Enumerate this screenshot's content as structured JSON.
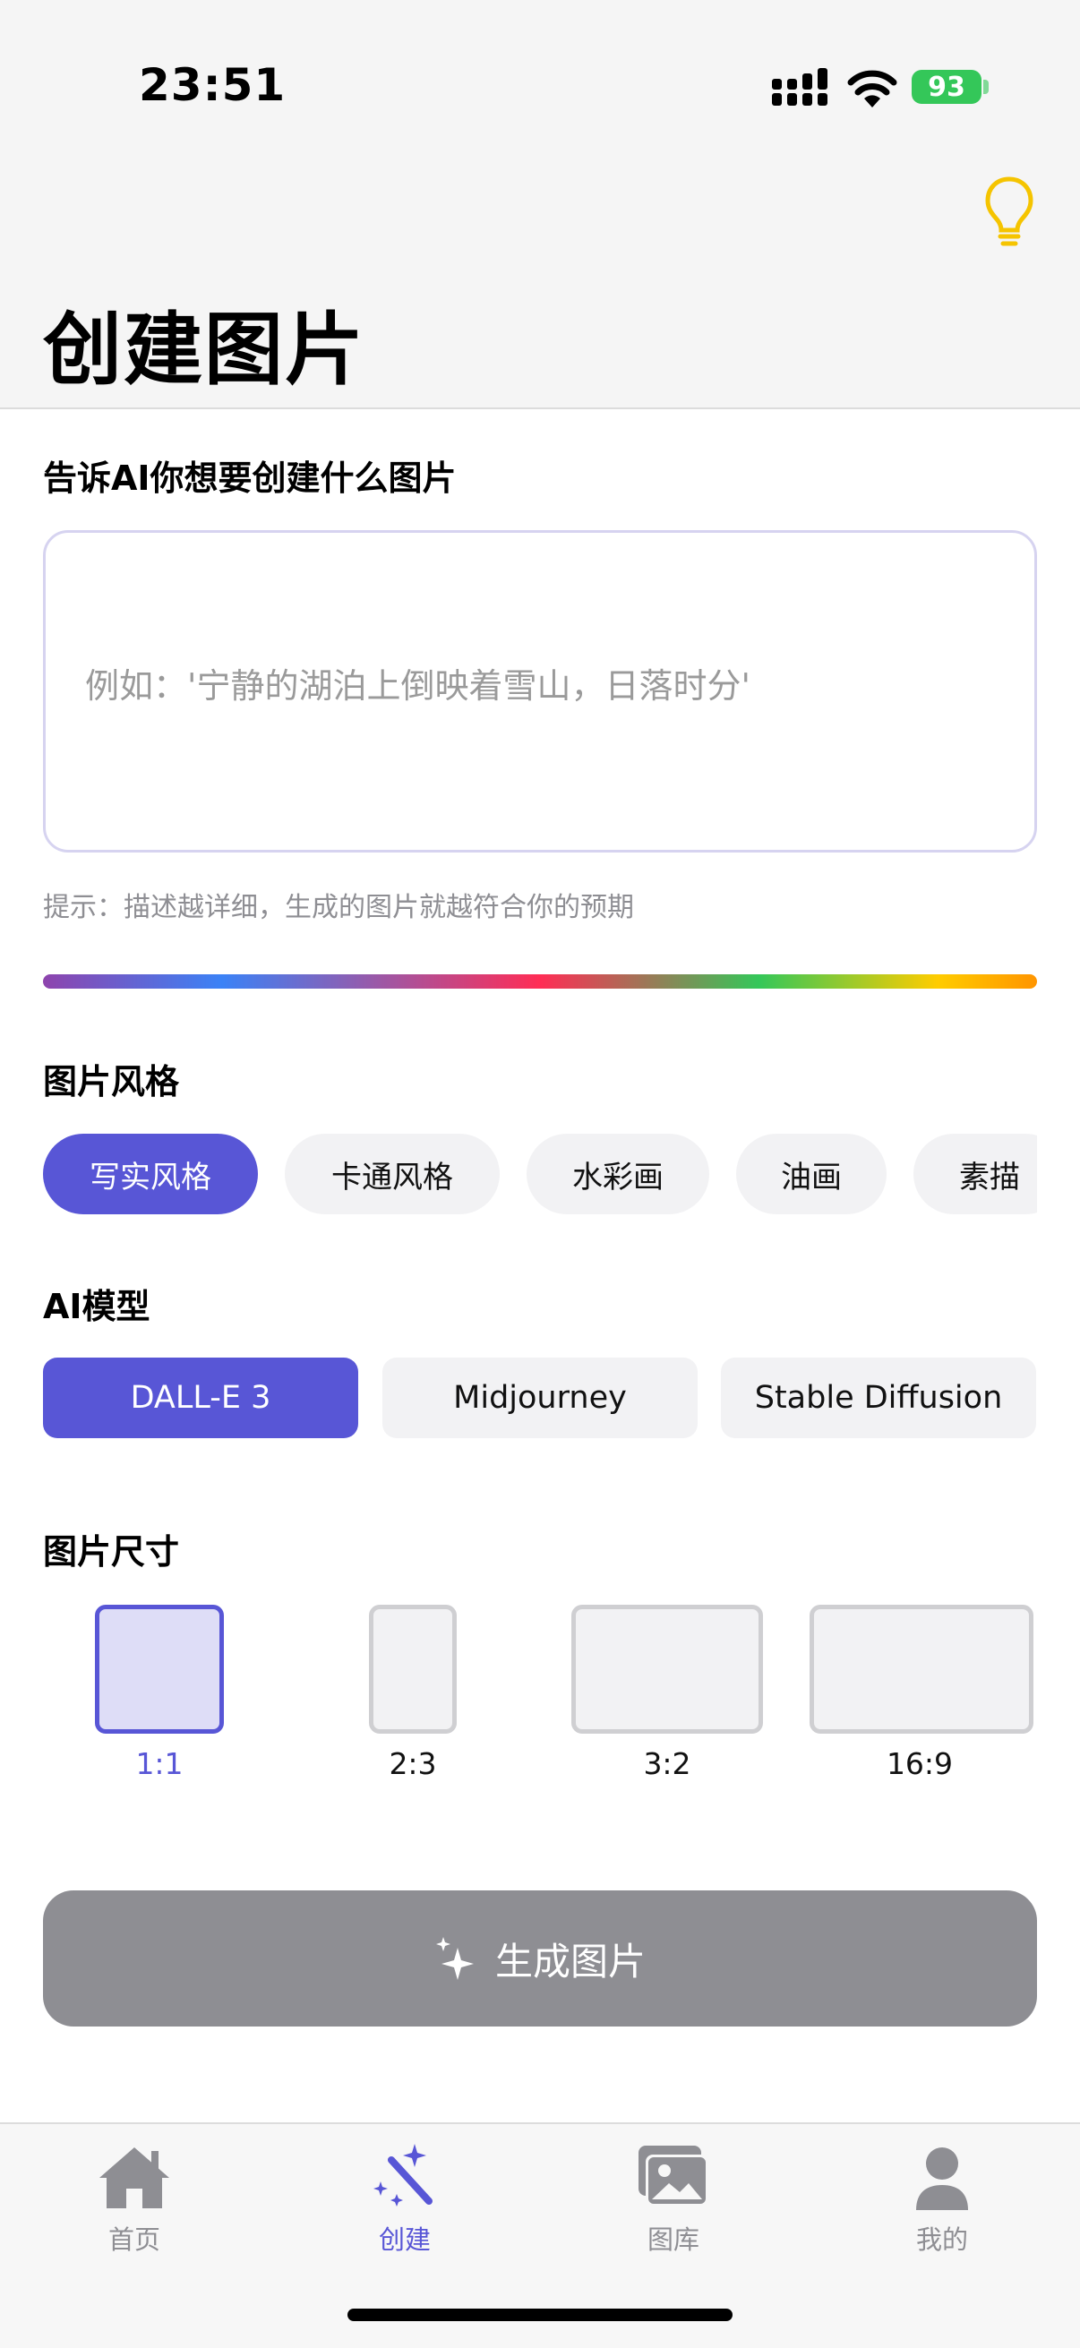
{
  "status_bar": {
    "time": "23:51",
    "battery": "93"
  },
  "header": {
    "title": "创建图片"
  },
  "prompt": {
    "label": "告诉AI你想要创建什么图片",
    "placeholder": "例如：'宁静的湖泊上倒映着雪山，日落时分'",
    "value": "",
    "hint": "提示：描述越详细，生成的图片就越符合你的预期"
  },
  "style": {
    "label": "图片风格",
    "selected": "写实风格",
    "options": [
      "写实风格",
      "卡通风格",
      "水彩画",
      "油画",
      "素描"
    ]
  },
  "model": {
    "label": "AI模型",
    "selected": "DALL-E 3",
    "options": [
      "DALL-E 3",
      "Midjourney",
      "Stable Diffusion"
    ]
  },
  "size": {
    "label": "图片尺寸",
    "selected": "1:1",
    "options": [
      "1:1",
      "2:3",
      "3:2",
      "16:9"
    ]
  },
  "generate_button": {
    "label": "生成图片",
    "icon": "sparkles-icon"
  },
  "tab_bar": {
    "active": "创建",
    "items": [
      {
        "label": "首页",
        "icon": "house-icon"
      },
      {
        "label": "创建",
        "icon": "magic-wand-icon"
      },
      {
        "label": "图库",
        "icon": "photo-gallery-icon"
      },
      {
        "label": "我的",
        "icon": "person-icon"
      }
    ]
  },
  "colors": {
    "accent": "#5856d6",
    "bulb": "#f5c400",
    "disabled_button": "#8e8e93",
    "battery": "#34c759"
  }
}
